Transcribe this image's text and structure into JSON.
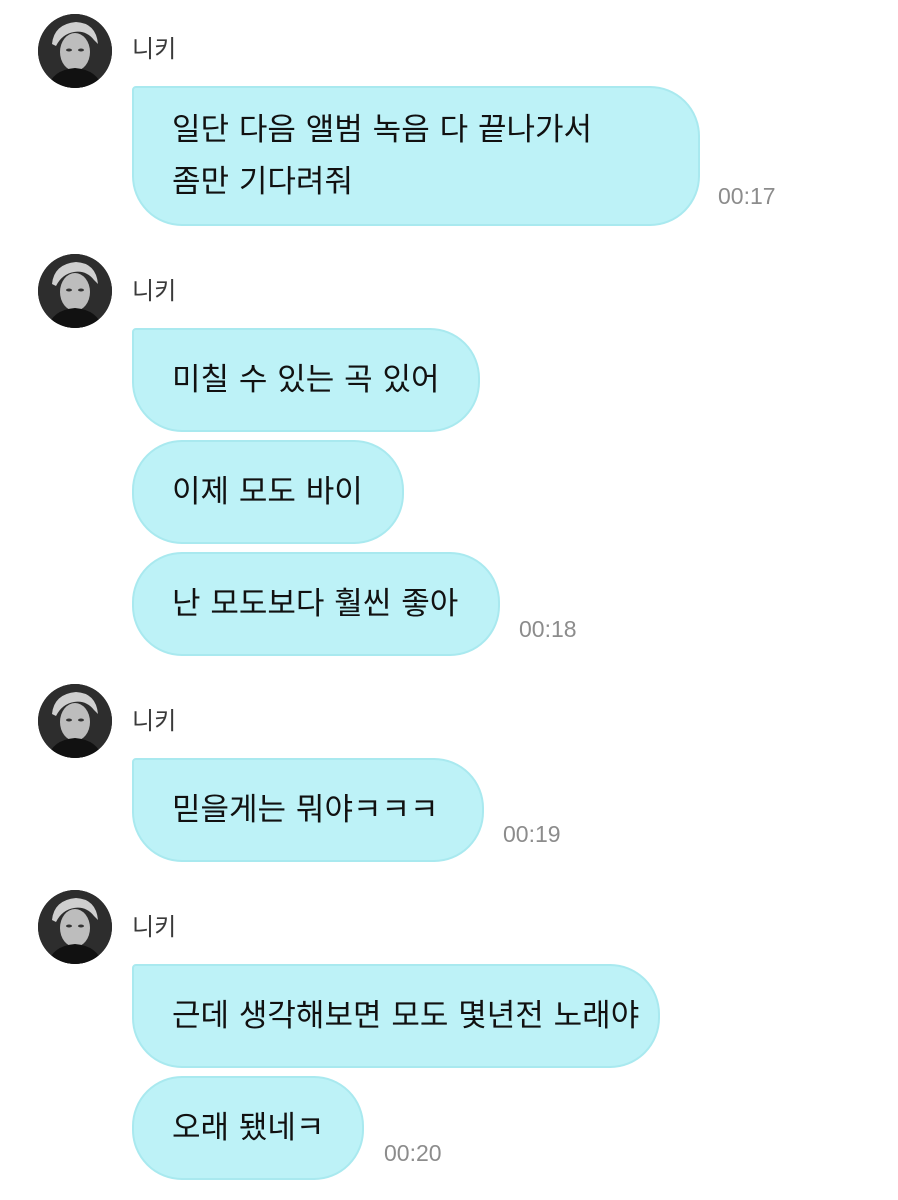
{
  "groups": [
    {
      "sender": "니키",
      "messages": [
        {
          "lines": [
            "일단 다음 앨범 녹음 다 끝나가서",
            "좀만 기다려줘"
          ],
          "time": "00:17"
        }
      ]
    },
    {
      "sender": "니키",
      "messages": [
        {
          "lines": [
            "미칠 수 있는 곡 있어"
          ],
          "time": ""
        },
        {
          "lines": [
            "이제 모도 바이"
          ],
          "time": ""
        },
        {
          "lines": [
            "난 모도보다 훨씬 좋아"
          ],
          "time": "00:18"
        }
      ]
    },
    {
      "sender": "니키",
      "messages": [
        {
          "lines": [
            "믿을게는 뭐야ㅋㅋㅋ"
          ],
          "time": "00:19"
        }
      ]
    },
    {
      "sender": "니키",
      "messages": [
        {
          "lines": [
            "근데 생각해보면 모도 몇년전 노래야"
          ],
          "time": ""
        },
        {
          "lines": [
            "오래 됐네ㅋ"
          ],
          "time": "00:20"
        }
      ]
    }
  ]
}
